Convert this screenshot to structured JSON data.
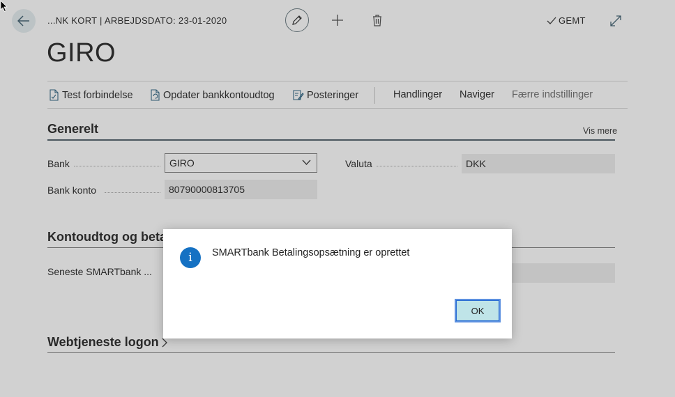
{
  "header": {
    "breadcrumb": "...NK KORT | ARBEJDSDATO: 23-01-2020",
    "title": "GIRO",
    "saved_label": "GEMT"
  },
  "icons": {
    "back": "arrow-left-icon",
    "edit": "pencil-icon",
    "new": "plus-icon",
    "delete": "trash-icon",
    "saved": "checkmark-icon",
    "expand": "expand-icon"
  },
  "actions": {
    "test_connection": "Test forbindelse",
    "update_statement": "Opdater bankkontoudtog",
    "postings": "Posteringer",
    "handlinger": "Handlinger",
    "naviger": "Naviger",
    "fewer_settings": "Færre indstillinger"
  },
  "general": {
    "title": "Generelt",
    "show_more": "Vis mere",
    "bank_label": "Bank",
    "bank_value": "GIRO",
    "account_label": "Bank konto",
    "account_value": "80790000813705",
    "currency_label": "Valuta",
    "currency_value": "DKK"
  },
  "statements": {
    "title": "Kontoudtog og beta",
    "latest_label": "Seneste SMARTbank ..."
  },
  "webservice": {
    "title": "Webtjeneste logon"
  },
  "dialog": {
    "message": "SMARTbank Betalingsopsætning er oprettet",
    "ok_label": "OK"
  },
  "colors": {
    "accent": "#1571c3",
    "ok_button": "#bfe4e8"
  }
}
